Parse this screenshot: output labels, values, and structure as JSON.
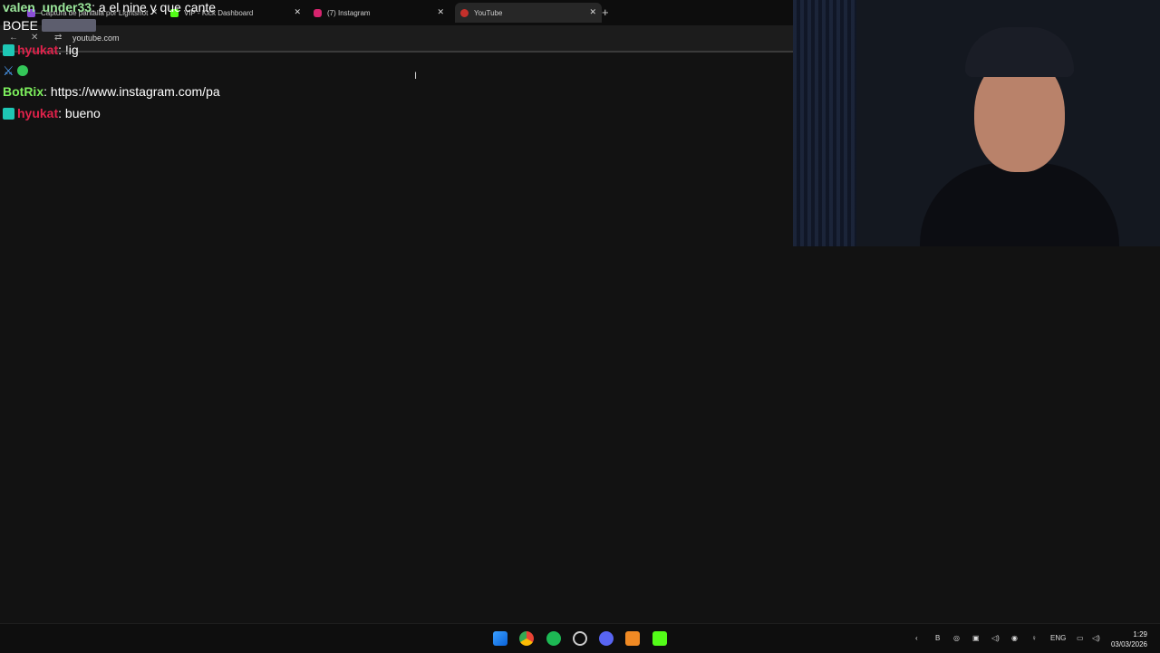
{
  "browser": {
    "tabs": [
      {
        "label": "Captura de pantalla por Lightshot",
        "icon": "lightshot-icon"
      },
      {
        "label": "VIP - Kick Dashboard",
        "icon": "kick-icon"
      },
      {
        "label": "(7) Instagram",
        "icon": "instagram-icon"
      },
      {
        "label": "YouTube",
        "icon": "youtube-icon"
      }
    ],
    "new_tab": "+",
    "close": "✕",
    "url": "youtube.com"
  },
  "chat": [
    {
      "user": "valen_under33",
      "sep": ": ",
      "text": "a el nine y que cante",
      "color": "#9be79b"
    },
    {
      "user": "BOEE",
      "sep": "",
      "text": "",
      "color": "#ffffff"
    },
    {
      "user": "hyukat",
      "sep": ": ",
      "text": "!ig",
      "color": "#e0224b"
    },
    {
      "user": "BotRix",
      "sep": ": ",
      "text": "https://www.instagram.com/pa",
      "color": "#7df05d"
    },
    {
      "user": "hyukat",
      "sep": ": ",
      "text": "bueno",
      "color": "#e0224b"
    }
  ],
  "taskbar": {
    "lang": "ENG",
    "time": "1:29",
    "date": "03/03/2026"
  }
}
